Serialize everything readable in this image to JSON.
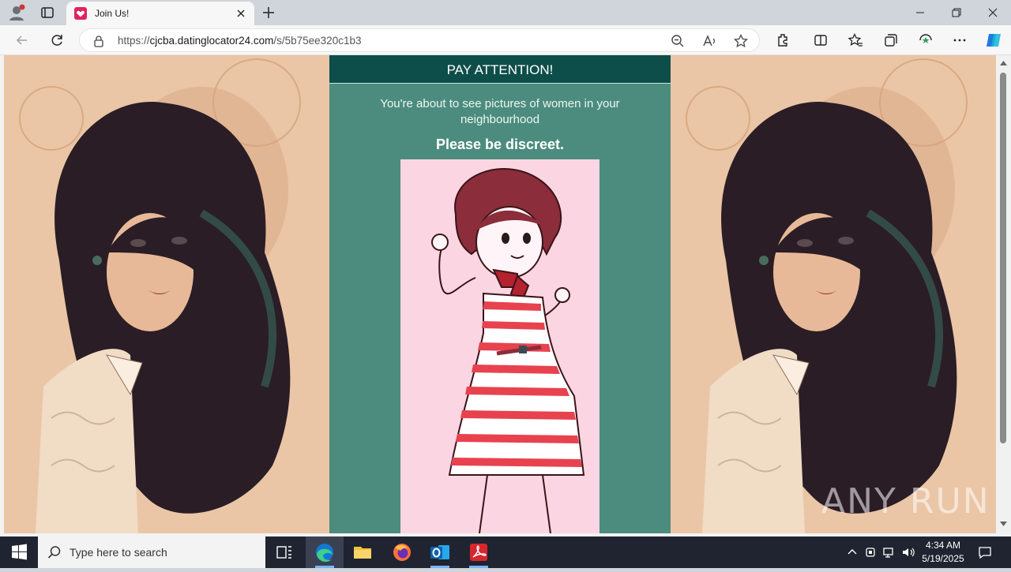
{
  "browser": {
    "tab_title": "Join Us!",
    "url_prefix": "https://",
    "url_host": "cjcba.datinglocator24.com",
    "url_path": "/s/5b75ee320c1b3"
  },
  "panel": {
    "title": "PAY ATTENTION!",
    "message": "You're about to see pictures of women in your neighbourhood",
    "emphasis": "Please be discreet."
  },
  "watermark": "ANY RUN",
  "taskbar": {
    "search_placeholder": "Type here to search",
    "time": "4:34 AM",
    "date": "5/19/2025"
  },
  "icons": {
    "profile": "profile-icon",
    "tab_favicon": "heart-favicon-icon",
    "edge": "edge-icon",
    "explorer": "file-explorer-icon",
    "firefox": "firefox-icon",
    "outlook": "outlook-icon",
    "acrobat": "acrobat-icon"
  },
  "colors": {
    "panel_bg": "#4c8c7e",
    "panel_header": "#0e4e4a",
    "picture_bg": "#fbd6e2",
    "dress_red": "#e8424f"
  }
}
